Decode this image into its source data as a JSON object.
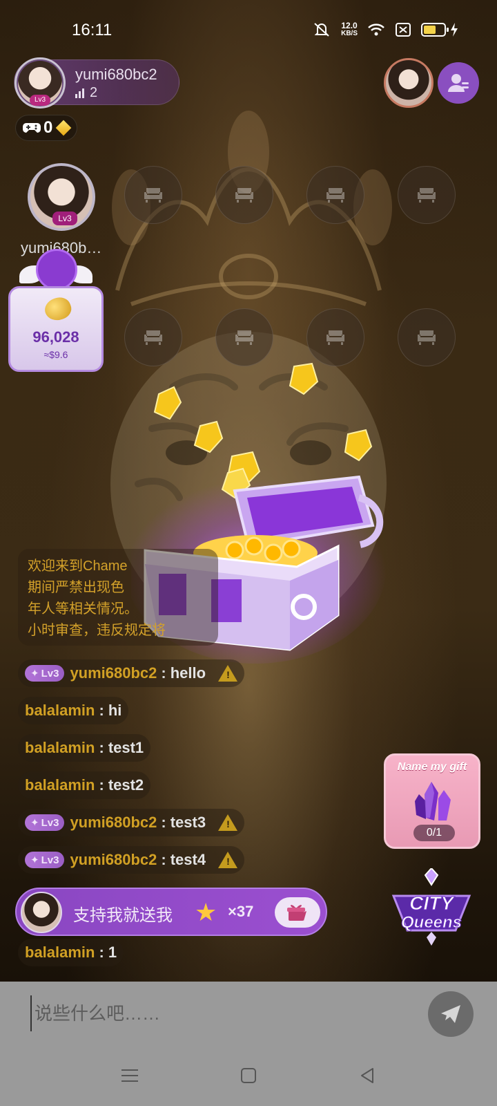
{
  "status_bar": {
    "time": "16:11",
    "net_speed_value": "12.0",
    "net_speed_unit": "KB/S",
    "battery_level": 0.62
  },
  "host": {
    "name": "yumi680bc2",
    "level": "Lv3",
    "audience_count": "2",
    "gamepad_count": "0"
  },
  "seats": {
    "owner_name": "yumi680b…",
    "owner_level": "Lv3"
  },
  "coin_box": {
    "value": "96,028",
    "usd": "≈$9.6"
  },
  "welcome_message": [
    "欢迎来到Chame",
    "期间严禁出现色",
    "年人等相关情况。",
    "小时审查，违反规定将"
  ],
  "chat": [
    {
      "level": "Lv3",
      "user": "yumi680bc2",
      "sep": ":",
      "text": "hello",
      "warning": true
    },
    {
      "level": "",
      "user": "balalamin",
      "sep": ":",
      "text": "hi",
      "warning": false
    },
    {
      "level": "",
      "user": "balalamin",
      "sep": ":",
      "text": "test1",
      "warning": false
    },
    {
      "level": "",
      "user": "balalamin",
      "sep": ":",
      "text": "test2",
      "warning": false
    },
    {
      "level": "Lv3",
      "user": "yumi680bc2",
      "sep": ":",
      "text": "test3",
      "warning": true
    },
    {
      "level": "Lv3",
      "user": "yumi680bc2",
      "sep": ":",
      "text": "test4",
      "warning": true
    },
    {
      "level": "",
      "user": "balalamin",
      "sep": ":",
      "text": "1",
      "warning": false
    }
  ],
  "support_bar": {
    "text": "支持我就送我",
    "count": "×37"
  },
  "name_my_gift": {
    "title": "Name my gift",
    "progress": "0/1"
  },
  "city_queens": {
    "line1": "CITY",
    "line2": "Queens"
  },
  "input": {
    "placeholder": "说些什么吧……"
  },
  "colors": {
    "accent_purple": "#8a47c2",
    "username_gold": "#d1a024",
    "warning": "#c49b1e"
  }
}
